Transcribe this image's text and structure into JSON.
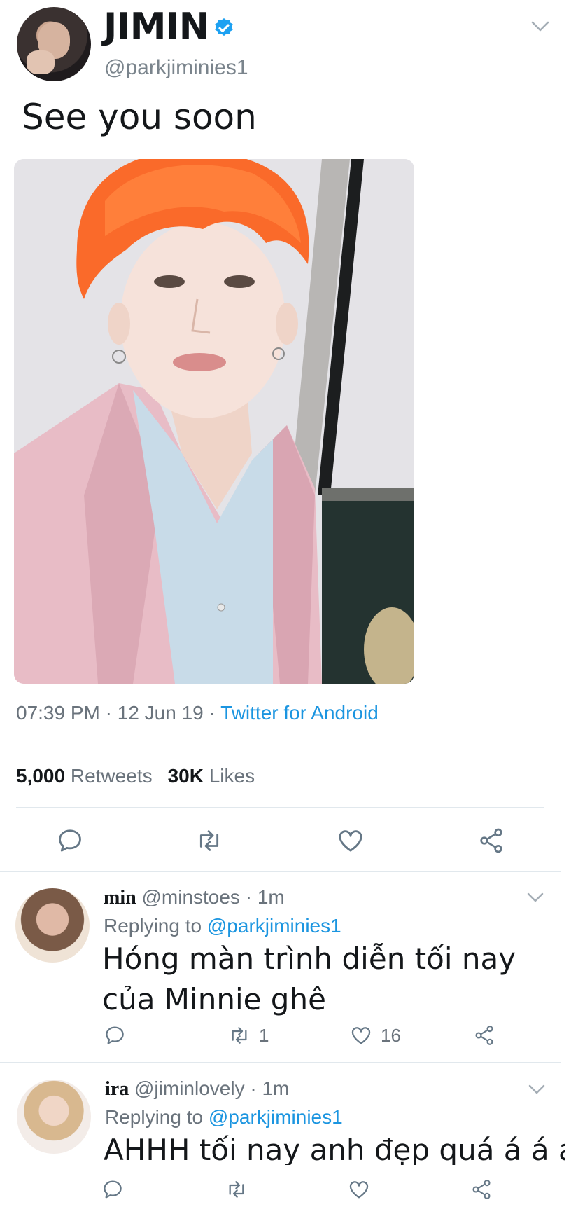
{
  "main_tweet": {
    "display_name": "JIMIN",
    "handle": "@parkjiminies1",
    "text": "See you soon",
    "time": "07:39 PM",
    "date": "12 Jun 19",
    "source": "Twitter for Android",
    "retweet_count": "5,000",
    "retweets_label": "Retweets",
    "like_count": "30K",
    "likes_label": "Likes"
  },
  "replies": [
    {
      "name": "min",
      "handle": "@minstoes",
      "age": "1m",
      "replying_label": "Replying to",
      "replying_to": "@parkjiminies1",
      "text": "Hóng màn trình diễn tối nay của Minnie ghê",
      "retweets": "1",
      "likes": "16"
    },
    {
      "name": "ira",
      "handle": "@jiminlovely",
      "age": "1m",
      "replying_label": "Replying to",
      "replying_to": "@parkjiminies1",
      "text": "AHHH tối nay anh đẹp quá á á á"
    }
  ],
  "separator": "·",
  "colors": {
    "link": "#1b95e0",
    "secondary_text": "#6a737c",
    "primary_text": "#14171a",
    "verified_badge": "#1da1f2",
    "divider": "#e1e8ed"
  },
  "icons": [
    "verified-icon",
    "chevron-down-icon",
    "reply-icon",
    "retweet-icon",
    "like-icon",
    "share-icon"
  ]
}
